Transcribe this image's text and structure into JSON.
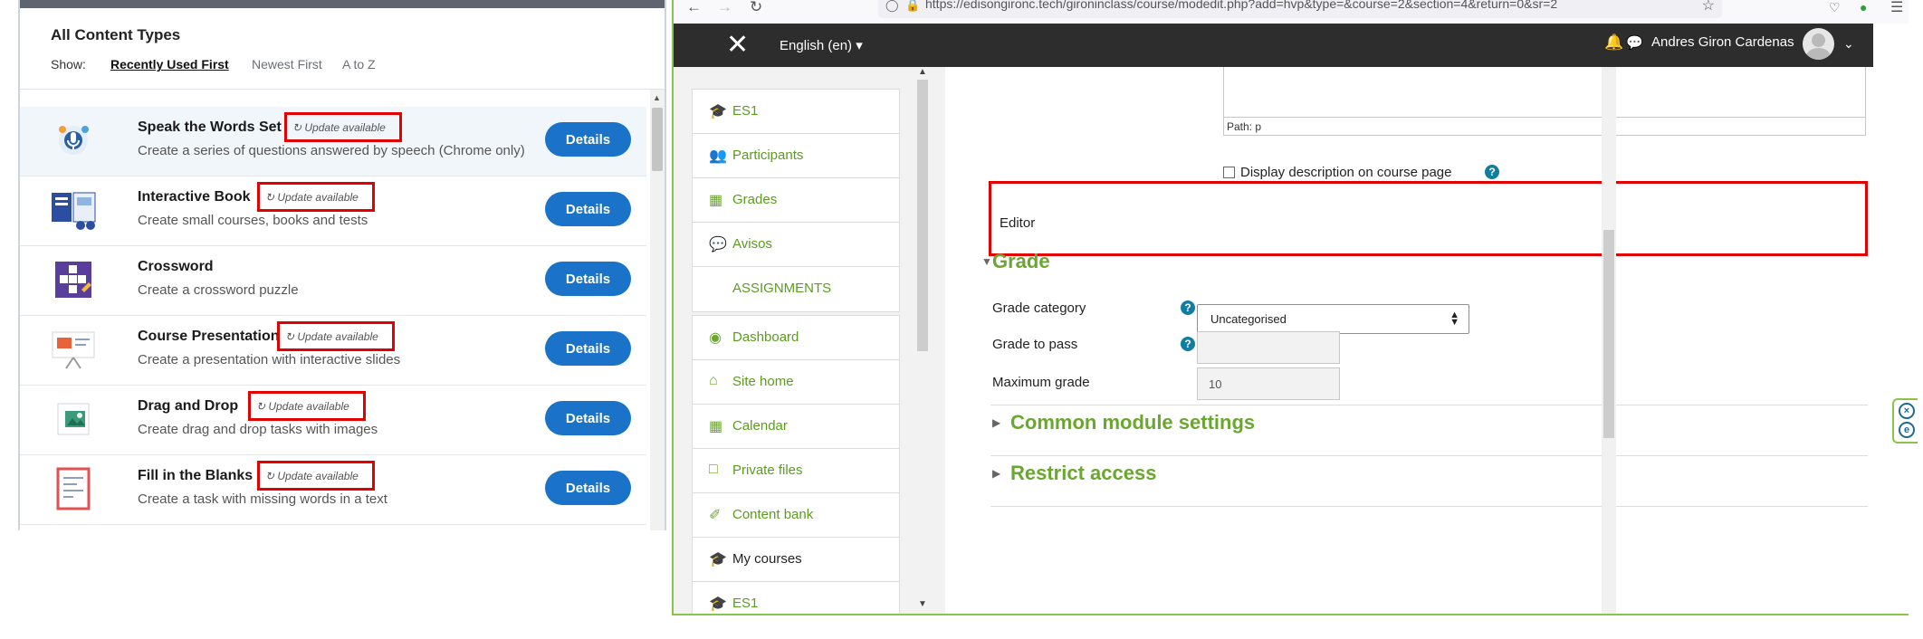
{
  "h5p": {
    "title": "All Content Types",
    "show_label": "Show:",
    "sort_options": [
      "Recently Used First",
      "Newest First",
      "A to Z"
    ],
    "items": [
      {
        "name": "Speak the Words Set",
        "desc": "Create a series of questions answered by speech (Chrome only)",
        "update": "Update available",
        "details": "Details",
        "icon": "microphone-icon"
      },
      {
        "name": "Interactive Book",
        "desc": "Create small courses, books and tests",
        "update": "Update available",
        "details": "Details",
        "icon": "book-icon"
      },
      {
        "name": "Crossword",
        "desc": "Create a crossword puzzle",
        "update": "",
        "details": "Details",
        "icon": "crossword-icon"
      },
      {
        "name": "Course Presentation",
        "desc": "Create a presentation with interactive slides",
        "update": "Update available",
        "details": "Details",
        "icon": "presentation-icon"
      },
      {
        "name": "Drag and Drop",
        "desc": "Create drag and drop tasks with images",
        "update": "Update available",
        "details": "Details",
        "icon": "drag-drop-icon"
      },
      {
        "name": "Fill in the Blanks",
        "desc": "Create a task with missing words in a text",
        "update": "Update available",
        "details": "Details",
        "icon": "fill-blanks-icon"
      }
    ]
  },
  "browser": {
    "url": "https://edisongironc.tech/gironinclass/course/modedit.php?add=hvp&type=&course=2&section=4&return=0&sr=2"
  },
  "navbar": {
    "language": "English (en)",
    "user_name": "Andres Giron Cardenas"
  },
  "drawer": {
    "course_items": [
      {
        "label": "ES1",
        "icon": "graduation-cap-icon"
      },
      {
        "label": "Participants",
        "icon": "users-icon"
      },
      {
        "label": "Grades",
        "icon": "table-icon"
      },
      {
        "label": "Avisos",
        "icon": "forum-icon"
      },
      {
        "label": "ASSIGNMENTS",
        "icon": ""
      }
    ],
    "site_items": [
      {
        "label": "Dashboard",
        "icon": "dashboard-icon"
      },
      {
        "label": "Site home",
        "icon": "home-icon"
      },
      {
        "label": "Calendar",
        "icon": "calendar-icon"
      },
      {
        "label": "Private files",
        "icon": "file-icon"
      },
      {
        "label": "Content bank",
        "icon": "brush-icon"
      },
      {
        "label": "My courses",
        "icon": "graduation-cap-icon"
      },
      {
        "label": "ES1",
        "icon": "graduation-cap-icon"
      }
    ]
  },
  "form": {
    "editor_path": "Path: p",
    "display_description": "Display description on course page",
    "editor_label": "Editor",
    "grade_section": "Grade",
    "grade_category_label": "Grade category",
    "grade_category_value": "Uncategorised",
    "grade_to_pass_label": "Grade to pass",
    "grade_to_pass_value": "",
    "max_grade_label": "Maximum grade",
    "max_grade_value": "10",
    "common_module_settings": "Common module settings",
    "restrict_access": "Restrict access"
  },
  "colors": {
    "accent_green": "#6aa72e",
    "details_blue": "#1a73c8",
    "highlight_red": "#e30000",
    "navbar_dark": "#2d2d2d"
  }
}
